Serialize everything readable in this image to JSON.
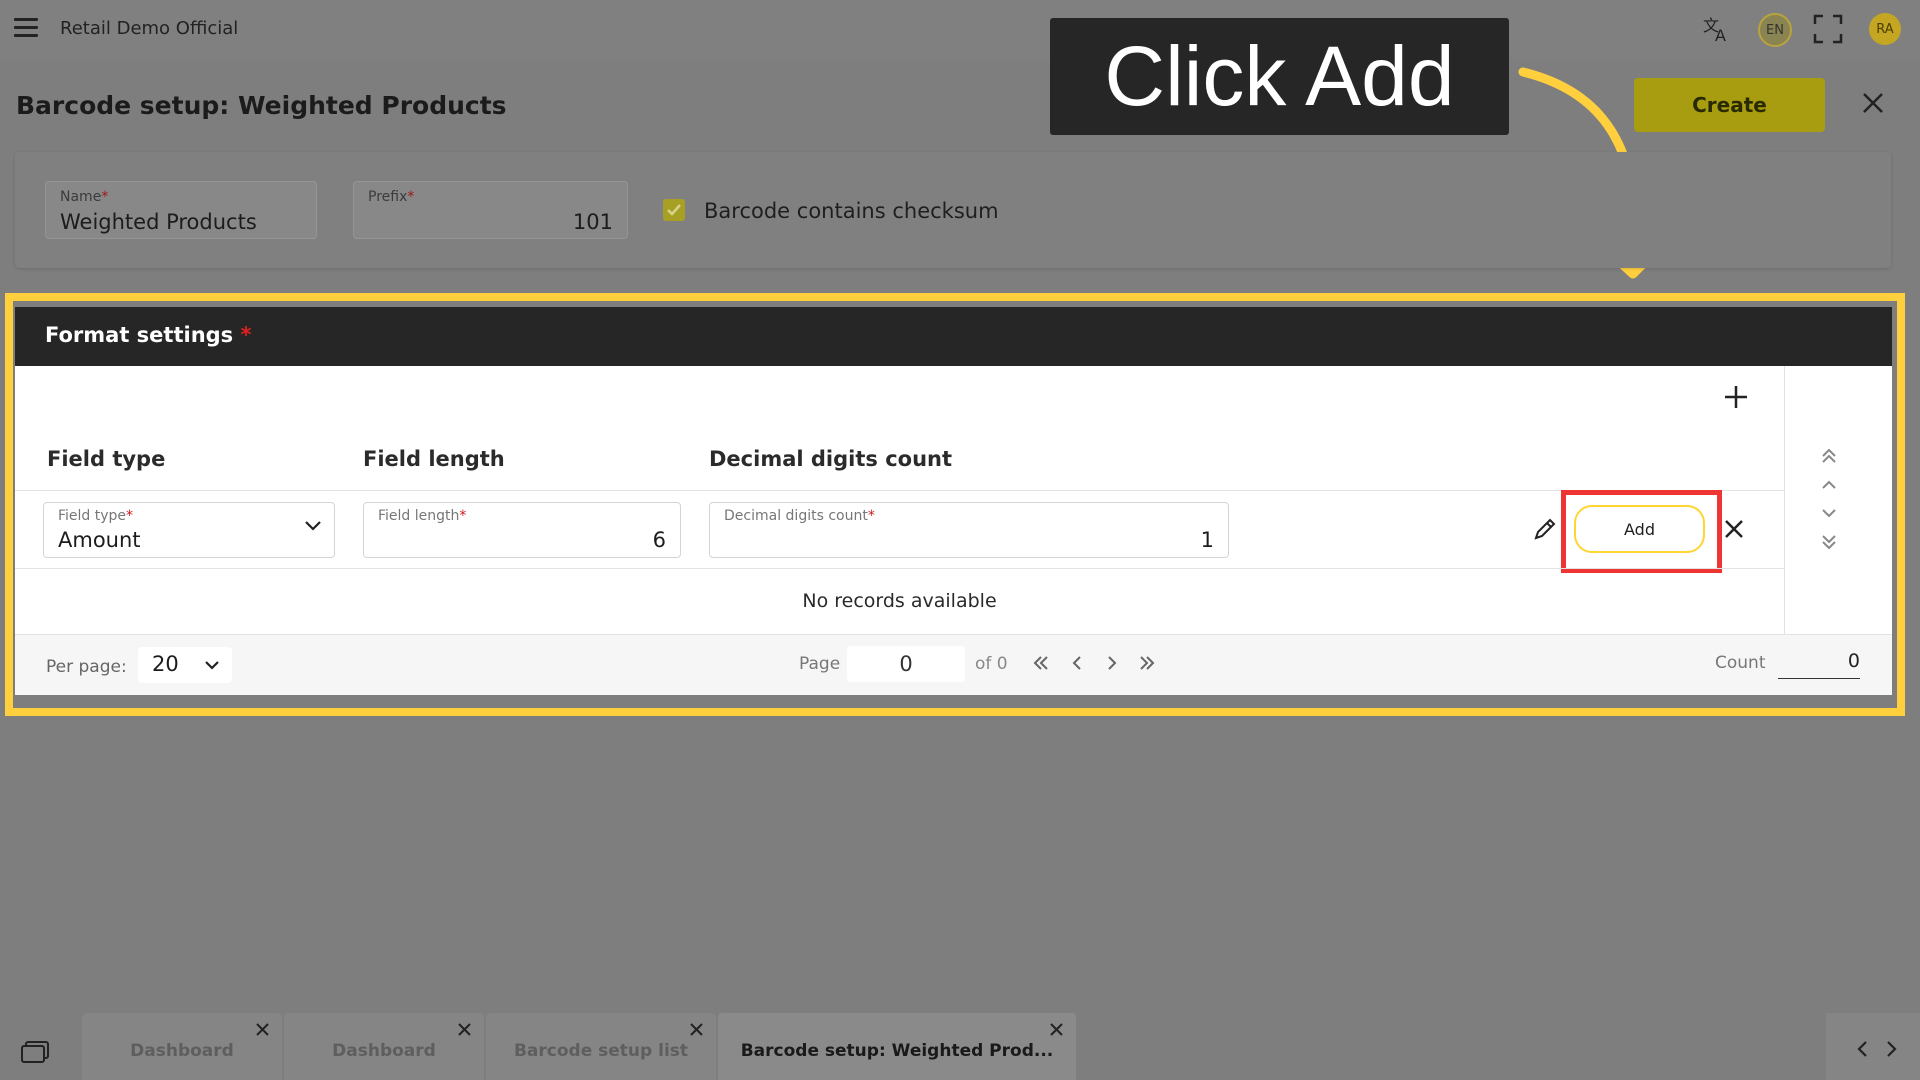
{
  "topbar": {
    "app_title": "Retail Demo Official",
    "lang_badge": "EN",
    "avatar_initials": "RA"
  },
  "page": {
    "title": "Barcode setup: Weighted Products",
    "create_label": "Create"
  },
  "callout": {
    "text": "Click Add"
  },
  "general": {
    "name_label": "Name",
    "name_value": "Weighted Products",
    "prefix_label": "Prefix",
    "prefix_value": "101",
    "checksum_label": "Barcode contains checksum",
    "required_mark": "*"
  },
  "format": {
    "title": "Format settings",
    "required_mark": "*",
    "columns": [
      "Field type",
      "Field length",
      "Decimal digits count"
    ],
    "editor": {
      "field_type_label": "Field type",
      "field_type_value": "Amount",
      "field_length_label": "Field length",
      "field_length_value": "6",
      "decimal_label": "Decimal digits count",
      "decimal_value": "1",
      "add_label": "Add"
    },
    "empty_text": "No records available",
    "footer": {
      "per_page_label": "Per page:",
      "per_page_value": "20",
      "page_label": "Page",
      "page_value": "0",
      "of_label": "of 0",
      "count_label": "Count",
      "count_value": "0"
    }
  },
  "tabs": [
    {
      "label": "Dashboard"
    },
    {
      "label": "Dashboard"
    },
    {
      "label": "Barcode setup list"
    },
    {
      "label": "Barcode setup: Weighted Prod..."
    }
  ],
  "colors": {
    "accent_yellow": "#ffcf3d",
    "highlight_red": "#ef3434",
    "create_button": "#a89d10",
    "header_dark": "#262626"
  }
}
